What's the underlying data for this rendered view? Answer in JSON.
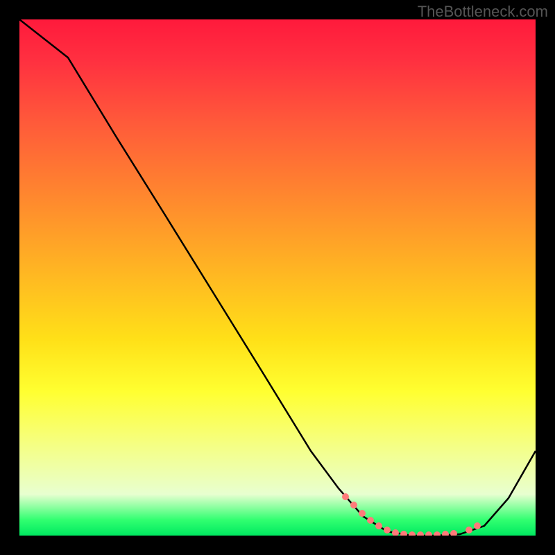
{
  "watermark": "TheBottleneck.com",
  "chart_data": {
    "type": "line",
    "title": "",
    "xlabel": "",
    "ylabel": "",
    "xlim": [
      0,
      100
    ],
    "ylim": [
      0,
      100
    ],
    "x": [
      0,
      10,
      20,
      30,
      40,
      50,
      60,
      65,
      70,
      75,
      80,
      85,
      90,
      95,
      100
    ],
    "values": [
      100,
      93,
      77,
      62,
      47,
      32,
      16,
      9,
      3,
      0,
      0,
      0,
      2,
      8,
      16
    ],
    "annotations": "Bottleneck/performance-fit curve; dotted pink markers along the valley floor between x≈64 and x≈90",
    "gradient_background": [
      "#ff1a3c",
      "#ff8030",
      "#ffff30",
      "#00e860"
    ]
  }
}
